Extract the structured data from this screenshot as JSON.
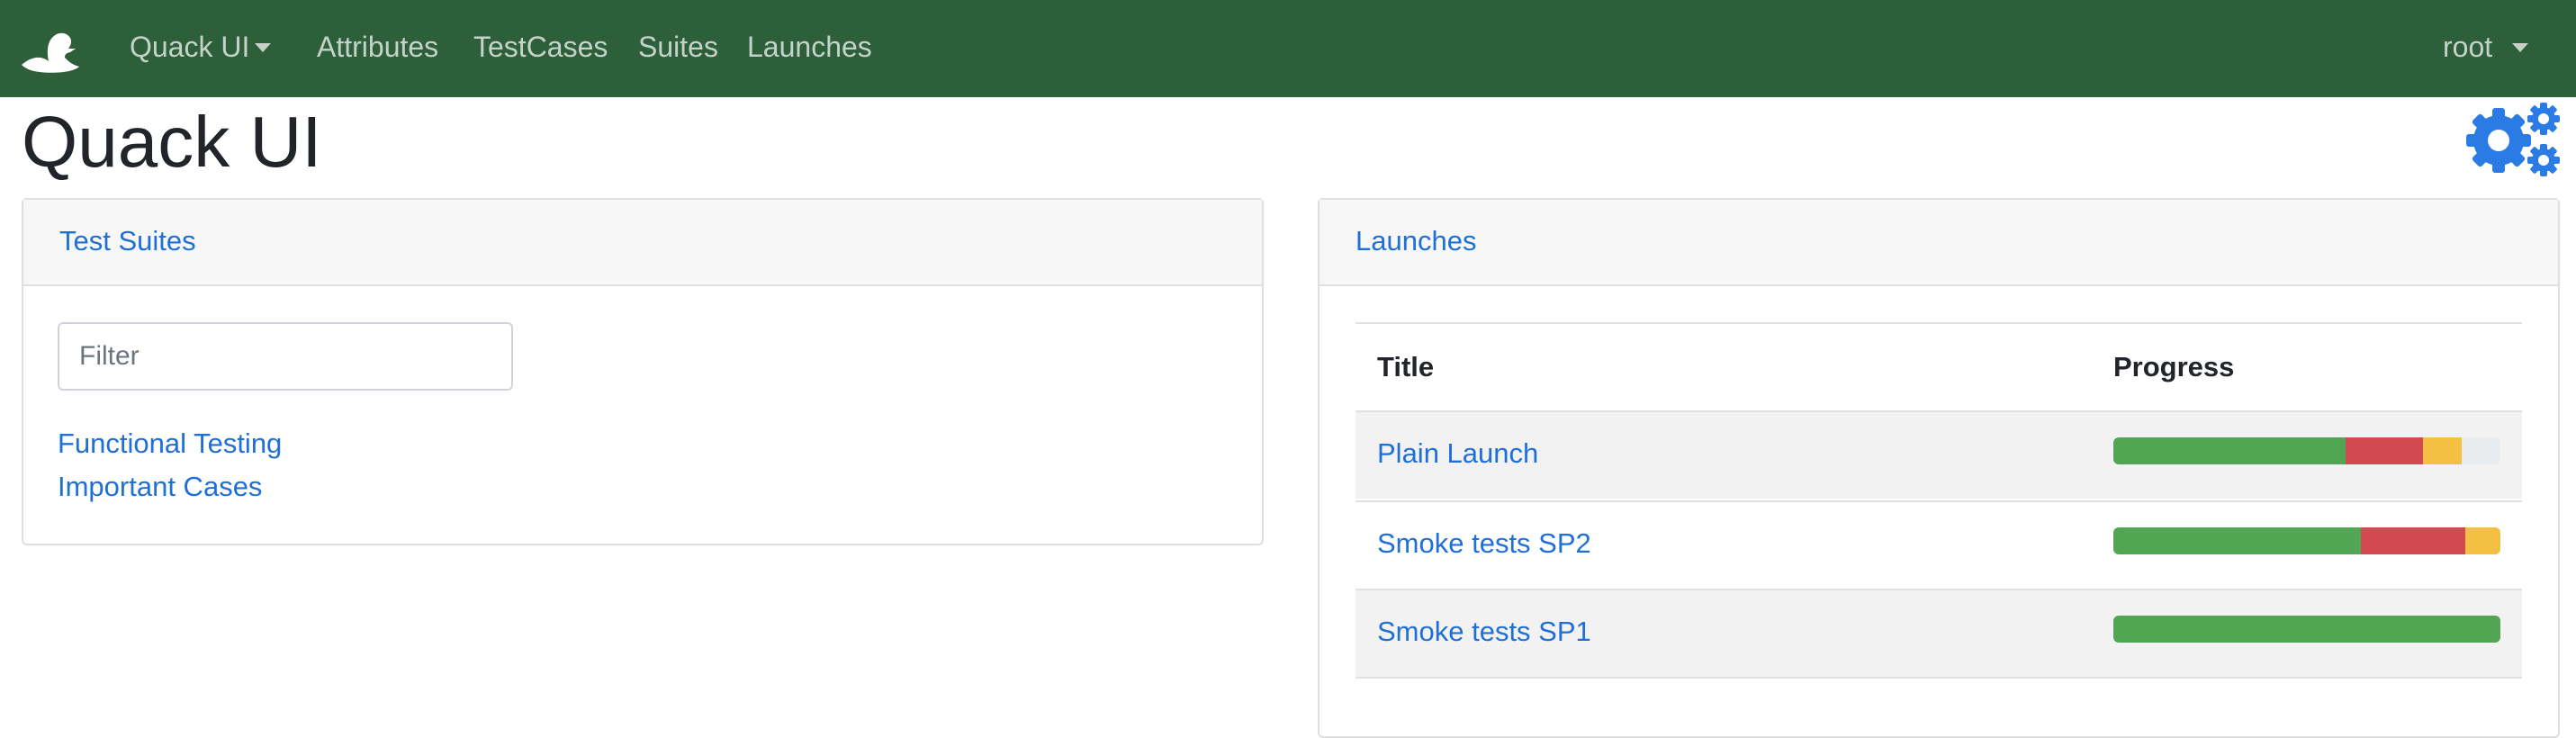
{
  "navbar": {
    "brand_menu": "Quack UI",
    "links": [
      "Attributes",
      "TestCases",
      "Suites",
      "Launches"
    ],
    "user": "root",
    "background": "#2c5f3a"
  },
  "page": {
    "title": "Quack UI",
    "settings_icon": "gears-icon"
  },
  "test_suites": {
    "header": "Test Suites",
    "filter_placeholder": "Filter",
    "filter_value": "",
    "items": [
      "Functional Testing",
      "Important Cases"
    ]
  },
  "launches": {
    "header": "Launches",
    "columns": [
      "Title",
      "Progress"
    ],
    "rows": [
      {
        "title": "Plain Launch",
        "progress": {
          "passed": 0.6,
          "failed": 0.2,
          "skipped": 0.1
        }
      },
      {
        "title": "Smoke tests SP2",
        "progress": {
          "passed": 0.64,
          "failed": 0.27,
          "skipped": 0.09
        }
      },
      {
        "title": "Smoke tests SP1",
        "progress": {
          "passed": 1.0,
          "failed": 0,
          "skipped": 0
        }
      }
    ]
  },
  "colors": {
    "link": "#1f6fd6",
    "passed": "#52a552",
    "failed": "#d24a4f",
    "skipped": "#f4c044",
    "track": "#e9ecef"
  }
}
